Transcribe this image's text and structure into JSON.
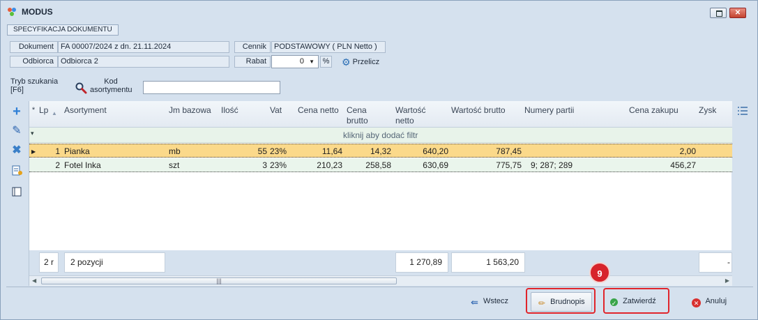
{
  "window": {
    "title": "MODUS"
  },
  "section_tab": "SPECYFIKACJA DOKUMENTU",
  "form": {
    "dokument_label": "Dokument",
    "dokument_value": "FA 00007/2024 z dn. 21.11.2024",
    "odbiorca_label": "Odbiorca",
    "odbiorca_value": "Odbiorca 2",
    "cennik_label": "Cennik",
    "cennik_value": "PODSTAWOWY ( PLN Netto )",
    "rabat_label": "Rabat",
    "rabat_value": "0",
    "rabat_unit": "%",
    "przelicz_label": "Przelicz",
    "tryb_label_1": "Tryb szukania",
    "tryb_label_2": "[F6]",
    "kod_label_1": "Kod",
    "kod_label_2": "asortymentu",
    "kod_value": ""
  },
  "grid": {
    "columns": {
      "lp": "Lp",
      "asortyment": "Asortyment",
      "jm": "Jm bazowa",
      "ilosc": "Ilość",
      "vat": "Vat",
      "cena_netto": "Cena netto",
      "cena_brutto_1": "Cena",
      "cena_brutto_2": "brutto",
      "wartosc_netto_1": "Wartość",
      "wartosc_netto_2": "netto",
      "wartosc_brutto": "Wartość brutto",
      "numery_partii": "Numery partii",
      "cena_zakupu": "Cena zakupu",
      "zysk": "Zysk"
    },
    "filter_hint": "kliknij aby dodać filtr",
    "rows": [
      {
        "lp": "1",
        "asortyment": "Pianka",
        "jm": "mb",
        "ilosc": "55",
        "vat": "23%",
        "cena_netto": "11,64",
        "cena_brutto": "14,32",
        "wartosc_netto": "640,20",
        "wartosc_brutto": "787,45",
        "numery_partii": "",
        "cena_zakupu": "2,00"
      },
      {
        "lp": "2",
        "asortyment": "Fotel Inka",
        "jm": "szt",
        "ilosc": "3",
        "vat": "23%",
        "cena_netto": "210,23",
        "cena_brutto": "258,58",
        "wartosc_netto": "630,69",
        "wartosc_brutto": "775,75",
        "numery_partii": "9; 287; 289",
        "cena_zakupu": "456,27"
      }
    ],
    "footer": {
      "count_short": "2 r",
      "positions": "2 pozycji",
      "sum_netto": "1 270,89",
      "sum_brutto": "1 563,20",
      "zysk": "-"
    }
  },
  "buttons": {
    "wstecz": "Wstecz",
    "brudnopis": "Brudnopis",
    "zatwierdz": "Zatwierdź",
    "anuluj": "Anuluj"
  },
  "annotation": {
    "badge": "9"
  },
  "colors": {
    "selected_row": "#fbd98a",
    "highlight": "#e0242b",
    "window_bg": "#d5e1ee"
  }
}
